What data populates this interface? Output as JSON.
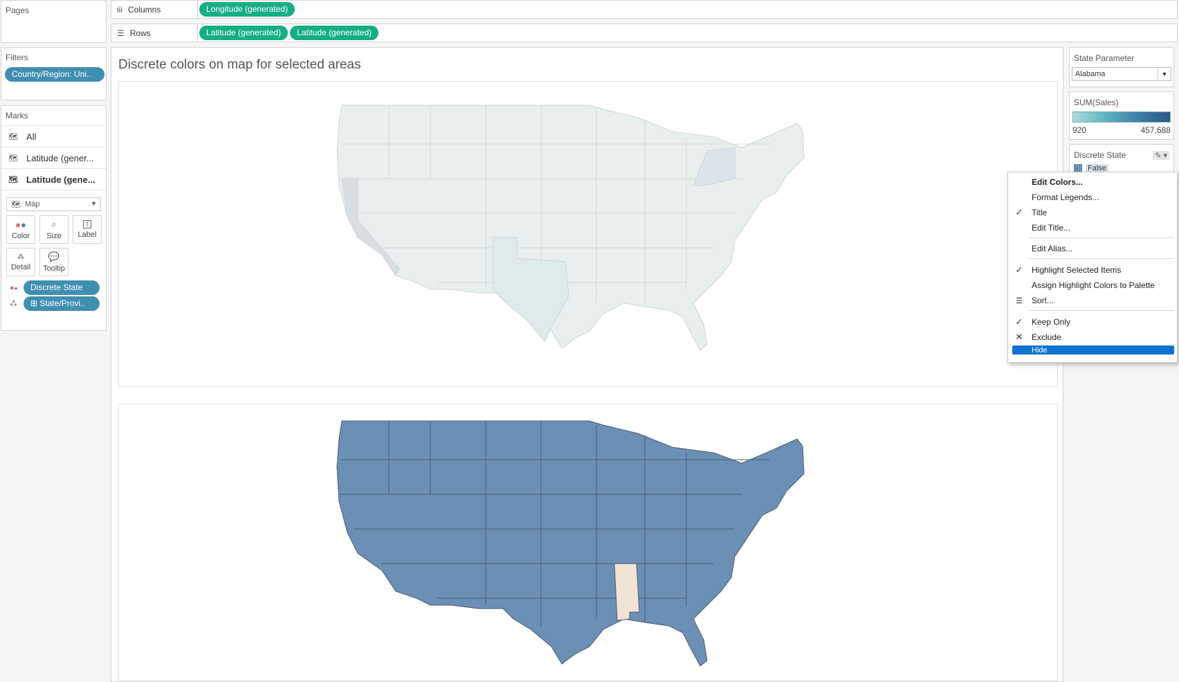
{
  "left": {
    "pages_title": "Pages",
    "filters_title": "Filters",
    "filter_pill": "Country/Region: Uni..",
    "marks_title": "Marks",
    "marks_layers": [
      {
        "label": "All",
        "bold": false
      },
      {
        "label": "Latitude (gener...",
        "bold": false
      },
      {
        "label": "Latitude (gene...",
        "bold": true
      }
    ],
    "mark_type": "Map",
    "mark_buttons": [
      {
        "label": "Color",
        "icon": "color-dots-icon"
      },
      {
        "label": "Size",
        "icon": "size-icon"
      },
      {
        "label": "Label",
        "icon": "label-icon"
      },
      {
        "label": "Detail",
        "icon": "detail-icon"
      },
      {
        "label": "Tooltip",
        "icon": "tooltip-icon"
      }
    ],
    "shelf_pills": [
      {
        "label": "Discrete State",
        "icon": "color-dots-icon"
      },
      {
        "label": "⊞ State/Provi..",
        "icon": "detail-icon"
      }
    ]
  },
  "shelves": {
    "columns_label": "Columns",
    "columns_pills": [
      "Longitude (generated)"
    ],
    "rows_label": "Rows",
    "rows_pills": [
      "Latitude (generated)",
      "Latitude (generated)"
    ]
  },
  "sheet": {
    "title": "Discrete colors on map for selected areas"
  },
  "right": {
    "param_title": "State Parameter",
    "param_value": "Alabama",
    "sales_title": "SUM(Sales)",
    "sales_min": "920",
    "sales_max": "457,688",
    "discrete_title": "Discrete State",
    "discrete_item": "False"
  },
  "context_menu": {
    "items": [
      {
        "label": "Edit Colors...",
        "mark": "",
        "bold": true
      },
      {
        "label": "Format Legends...",
        "mark": ""
      },
      {
        "label": "Title",
        "mark": "✓"
      },
      {
        "label": "Edit Title...",
        "mark": ""
      },
      {
        "label": "Edit Alias...",
        "mark": ""
      },
      {
        "label": "Highlight Selected Items",
        "mark": "✓"
      },
      {
        "label": "Assign Highlight Colors to Palette",
        "mark": ""
      },
      {
        "label": "Sort...",
        "mark": "sort"
      },
      {
        "label": "Keep Only",
        "mark": "✓"
      },
      {
        "label": "Exclude",
        "mark": "✕"
      },
      {
        "label": "Hide",
        "mark": "",
        "highlighted": true
      }
    ]
  },
  "colors": {
    "green_pill": "#15ae85",
    "blue_pill": "#3f8fb1",
    "state_blue": "#6b8fb5",
    "alabama_beige": "#f1e4d4",
    "menu_highlight": "#0e73d0"
  }
}
